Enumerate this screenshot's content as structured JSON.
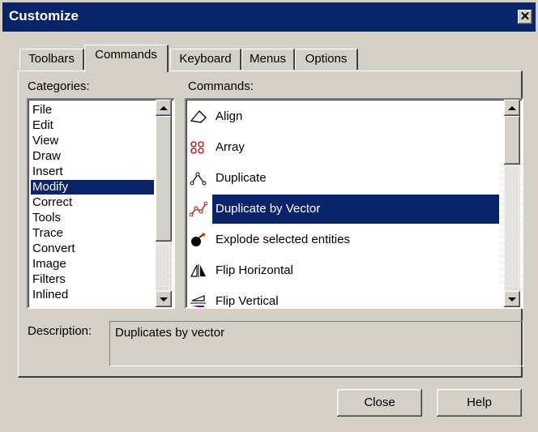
{
  "window": {
    "title": "Customize",
    "close_glyph": "✕"
  },
  "tabs": [
    {
      "label": "Toolbars"
    },
    {
      "label": "Commands"
    },
    {
      "label": "Keyboard"
    },
    {
      "label": "Menus"
    },
    {
      "label": "Options"
    }
  ],
  "active_tab": "Commands",
  "categories": {
    "label": "Categories:",
    "items": [
      "File",
      "Edit",
      "View",
      "Draw",
      "Insert",
      "Modify",
      "Correct",
      "Tools",
      "Trace",
      "Convert",
      "Image",
      "Filters",
      "Inlined"
    ],
    "selected": "Modify"
  },
  "commands": {
    "label": "Commands:",
    "items": [
      {
        "label": "Align",
        "icon": "align-icon"
      },
      {
        "label": "Array",
        "icon": "array-icon"
      },
      {
        "label": "Duplicate",
        "icon": "duplicate-icon"
      },
      {
        "label": "Duplicate by Vector",
        "icon": "duplicate-vector-icon"
      },
      {
        "label": "Explode selected entities",
        "icon": "bomb-icon"
      },
      {
        "label": "Flip Horizontal",
        "icon": "flip-horizontal-icon"
      },
      {
        "label": "Flip Vertical",
        "icon": "flip-vertical-icon"
      }
    ],
    "selected": "Duplicate by Vector"
  },
  "description": {
    "label": "Description:",
    "text": "Duplicates by vector"
  },
  "buttons": {
    "close": "Close",
    "help": "Help"
  },
  "colors": {
    "selection": "#0a246a",
    "face": "#d4d0c8"
  }
}
